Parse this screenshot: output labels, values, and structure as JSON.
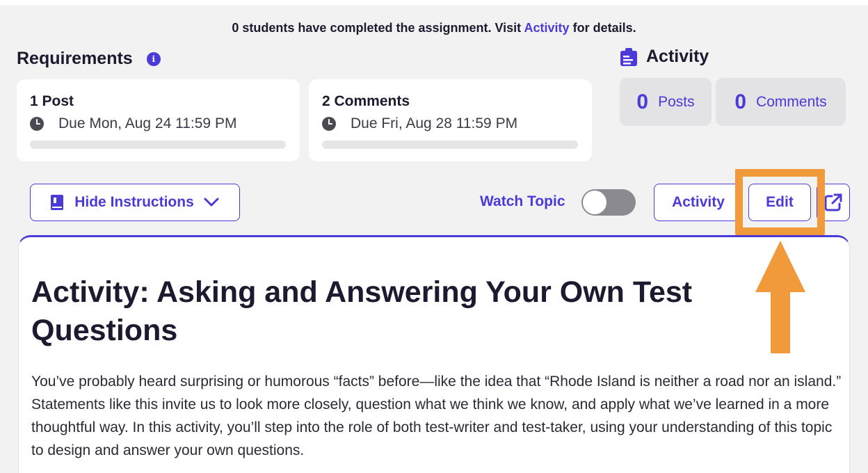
{
  "notice": {
    "prefix": "0 students have completed the assignment. Visit",
    "link": "Activity",
    "suffix": "for details."
  },
  "requirements": {
    "title": "Requirements",
    "info_glyph": "i",
    "items": [
      {
        "name": "1 Post",
        "due": "Due Mon, Aug 24 11:59 PM",
        "progress": 0
      },
      {
        "name": "2 Comments",
        "due": "Due Fri, Aug 28 11:59 PM",
        "progress": 0
      }
    ]
  },
  "activity": {
    "title": "Activity",
    "posts": {
      "count": "0",
      "label": "Posts"
    },
    "comments": {
      "count": "0",
      "label": "Comments"
    }
  },
  "toolbar": {
    "hide_instructions": "Hide Instructions",
    "watch_topic": "Watch Topic",
    "watch_enabled": false,
    "activity": "Activity",
    "edit": "Edit"
  },
  "content": {
    "title": "Activity: Asking and Answering Your Own Test Questions",
    "body": "You’ve probably heard surprising or humorous “facts” before—like the idea that “Rhode Island is neither a road nor an island.” Statements like this invite us to look more closely, question what we think we know, and apply what we’ve learned in a more thoughtful way. In this activity, you’ll step into the role of both test-writer and test-taker, using your understanding of this topic to design and answer your own questions."
  },
  "colors": {
    "accent": "#4a3ad8",
    "highlight": "#f09a3c",
    "background": "#f2f2f3"
  },
  "icons": {
    "info": "info-icon",
    "clock": "clock-icon",
    "activity": "clipboard-icon",
    "book": "book-icon",
    "chevron": "chevron-down-icon",
    "external": "external-link-icon"
  }
}
